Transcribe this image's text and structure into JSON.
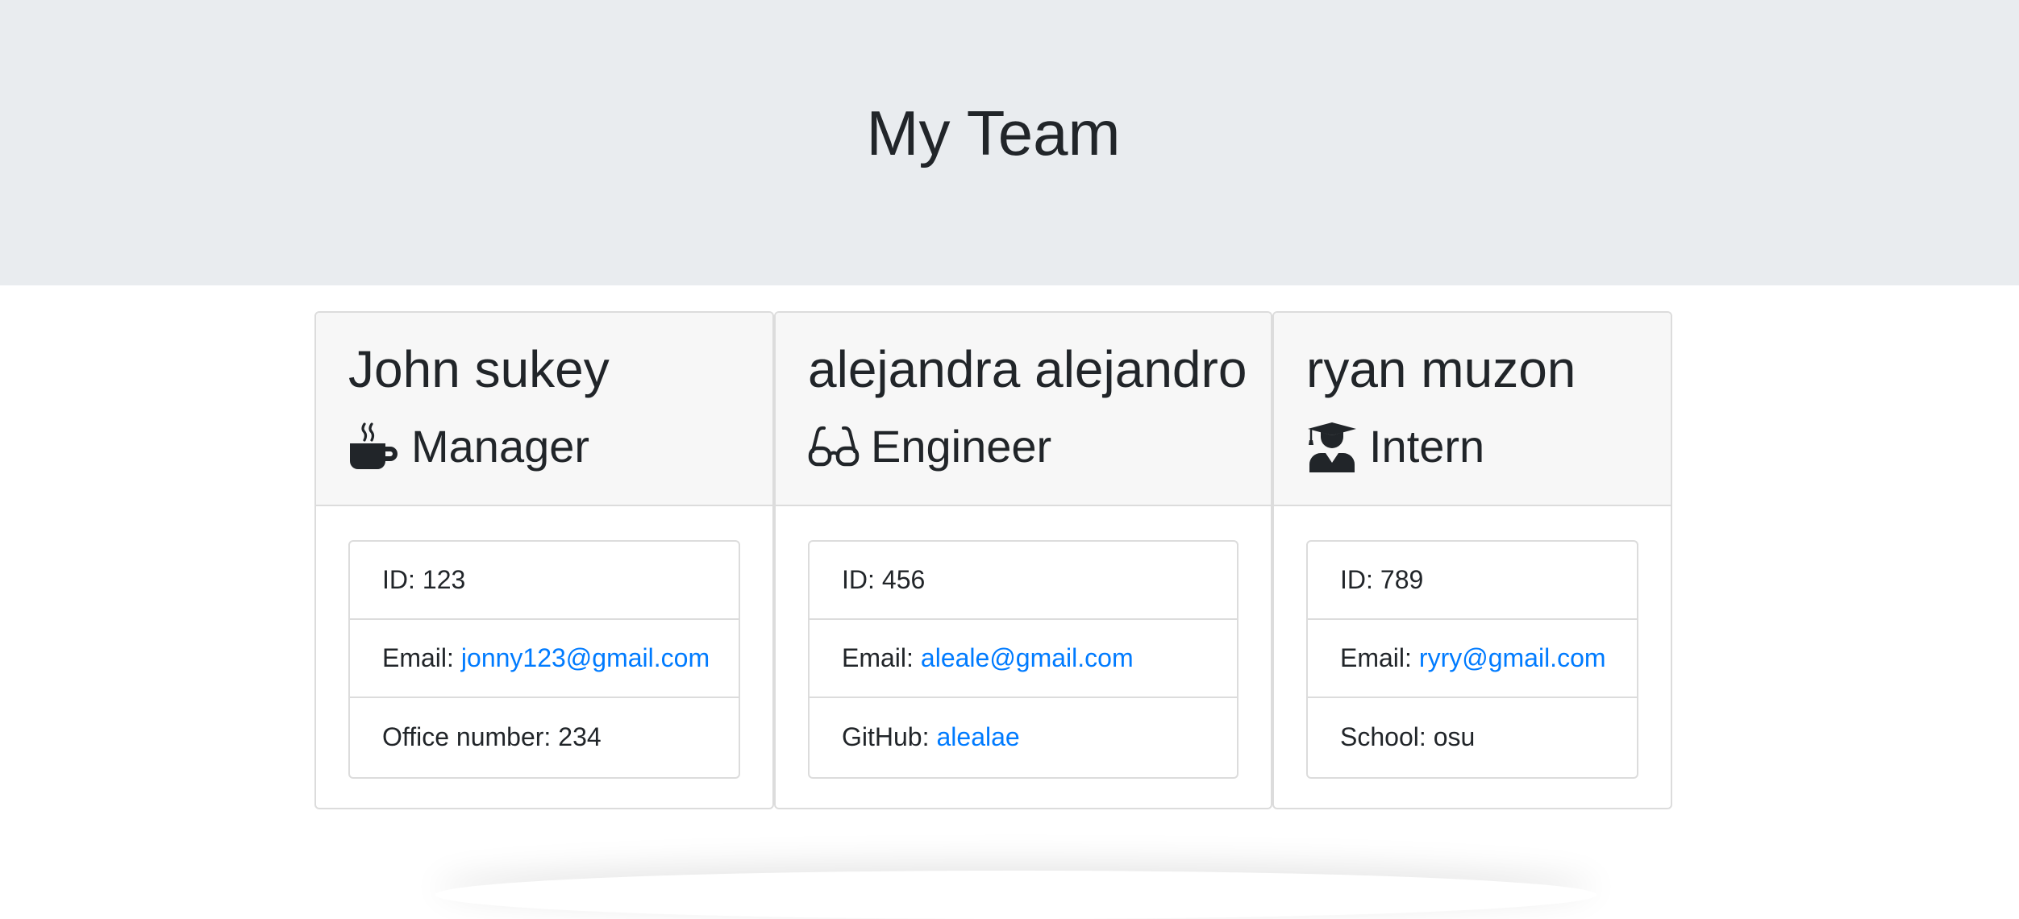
{
  "header": {
    "title": "My Team"
  },
  "employees": [
    {
      "name": "John sukey",
      "role": "Manager",
      "role_icon": "mug-hot-icon",
      "id_label": "ID:",
      "id": "123",
      "email_label": "Email:",
      "email": "jonny123@gmail.com",
      "extra_label": "Office number:",
      "extra_value": "234"
    },
    {
      "name": "alejandra alejandro",
      "role": "Engineer",
      "role_icon": "glasses-icon",
      "id_label": "ID:",
      "id": "456",
      "email_label": "Email:",
      "email": "aleale@gmail.com",
      "extra_label": "GitHub:",
      "extra_value": "alealae"
    },
    {
      "name": "ryan muzon",
      "role": "Intern",
      "role_icon": "user-graduate-icon",
      "id_label": "ID:",
      "id": "789",
      "email_label": "Email:",
      "email": "ryry@gmail.com",
      "extra_label": "School:",
      "extra_value": "osu"
    }
  ],
  "colors": {
    "jumbotron_bg": "#e9ecef",
    "card_header_bg": "#f7f7f7",
    "link": "#007bff",
    "text": "#212529",
    "border": "#dcdcdc"
  }
}
